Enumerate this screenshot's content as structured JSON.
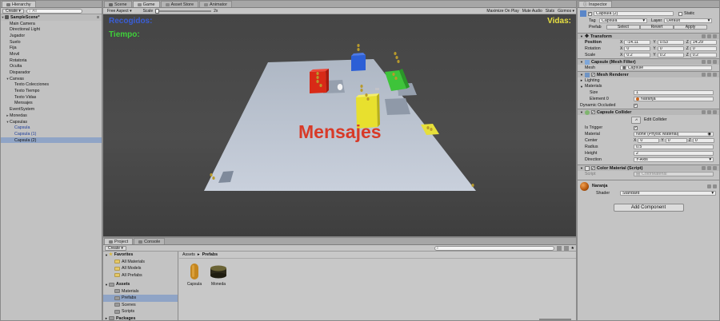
{
  "hierarchy": {
    "tab": "Hierarchy",
    "create": "Create",
    "search_placeholder": "All",
    "scene": "SampleScene*",
    "items": [
      {
        "label": "Main Camera",
        "indent": 1,
        "tw": "",
        "style": ""
      },
      {
        "label": "Directional Light",
        "indent": 1,
        "tw": "",
        "style": ""
      },
      {
        "label": "Jugador",
        "indent": 1,
        "tw": "",
        "style": ""
      },
      {
        "label": "Suelo",
        "indent": 1,
        "tw": "",
        "style": ""
      },
      {
        "label": "Fija",
        "indent": 1,
        "tw": "",
        "style": ""
      },
      {
        "label": "Movil",
        "indent": 1,
        "tw": "",
        "style": ""
      },
      {
        "label": "Rotatoria",
        "indent": 1,
        "tw": "",
        "style": ""
      },
      {
        "label": "Oculta",
        "indent": 1,
        "tw": "",
        "style": ""
      },
      {
        "label": "Disparador",
        "indent": 1,
        "tw": "",
        "style": ""
      },
      {
        "label": "Canvas",
        "indent": 1,
        "tw": "▼",
        "style": ""
      },
      {
        "label": "Texto Colecciones",
        "indent": 2,
        "tw": "",
        "style": ""
      },
      {
        "label": "Texto Tiempo",
        "indent": 2,
        "tw": "",
        "style": ""
      },
      {
        "label": "Texto Vidas",
        "indent": 2,
        "tw": "",
        "style": ""
      },
      {
        "label": "Mensajes",
        "indent": 2,
        "tw": "",
        "style": ""
      },
      {
        "label": "EventSystem",
        "indent": 1,
        "tw": "",
        "style": ""
      },
      {
        "label": "Monedas",
        "indent": 1,
        "tw": "►",
        "style": ""
      },
      {
        "label": "Capsulas",
        "indent": 1,
        "tw": "▼",
        "style": ""
      },
      {
        "label": "Capsula",
        "indent": 2,
        "tw": "",
        "style": "blue"
      },
      {
        "label": "Capsula (1)",
        "indent": 2,
        "tw": "",
        "style": "blue"
      },
      {
        "label": "Capsula (2)",
        "indent": 2,
        "tw": "",
        "style": "sel"
      }
    ]
  },
  "center": {
    "tabs": [
      {
        "label": "Scene",
        "icon": "hash",
        "active": false
      },
      {
        "label": "Game",
        "icon": "pacman",
        "active": true
      },
      {
        "label": "Asset Store",
        "icon": "bag",
        "active": false
      },
      {
        "label": "Animator",
        "icon": "anim",
        "active": false
      }
    ],
    "toolbar": {
      "aspect": "Free Aspect",
      "scale_label": "Scale",
      "scale_value": "2x",
      "maximize": "Maximize On Play",
      "mute": "Mute Audio",
      "stats": "Stats",
      "gizmos": "Gizmos"
    },
    "hud": {
      "colecciones": "Recogidos:",
      "tiempo": "Tiempo:",
      "vidas": "Vidas:",
      "mensajes": "Mensajes"
    }
  },
  "project": {
    "tabs": [
      {
        "label": "Project",
        "active": true
      },
      {
        "label": "Console",
        "active": false
      }
    ],
    "create": "Create",
    "favorites": "Favorites",
    "fav_items": [
      "All Materials",
      "All Models",
      "All Prefabs"
    ],
    "assets": "Assets",
    "asset_folders": [
      "Materials",
      "Prefabs",
      "Scenes",
      "Scripts"
    ],
    "packages": "Packages",
    "breadcrumb": [
      "Assets",
      "Prefabs"
    ],
    "items": [
      {
        "label": "Capsula"
      },
      {
        "label": "Moneda"
      }
    ]
  },
  "inspector": {
    "tab": "Inspector",
    "name": "Capsula (2)",
    "static": "Static",
    "tag_label": "Tag",
    "tag_value": "Capsula",
    "layer_label": "Layer",
    "layer_value": "Default",
    "prefab_label": "Prefab",
    "prefab_buttons": [
      "Select",
      "Revert",
      "Apply"
    ],
    "transform": {
      "title": "Transform",
      "rows": [
        {
          "label": "Position",
          "x": "-14.11",
          "y": "0.53",
          "z": "14.29"
        },
        {
          "label": "Rotation",
          "x": "0",
          "y": "0",
          "z": "0"
        },
        {
          "label": "Scale",
          "x": "0.2",
          "y": "0.2",
          "z": "0.2"
        }
      ]
    },
    "mesh_filter": {
      "title": "Capsule (Mesh Filter)",
      "mesh_label": "Mesh",
      "mesh_value": "Capsule"
    },
    "mesh_renderer": {
      "title": "Mesh Renderer",
      "lighting": "Lighting",
      "materials": "Materials",
      "size_label": "Size",
      "size_value": "1",
      "element_label": "Element 0",
      "element_value": "Naranja",
      "occluded": "Dynamic Occluded"
    },
    "collider": {
      "title": "Capsule Collider",
      "edit": "Edit Collider",
      "rows": [
        {
          "label": "Is Trigger",
          "value": ""
        },
        {
          "label": "Material",
          "value": "None (Physic Material)"
        },
        {
          "label": "Center",
          "x": "0",
          "y": "0",
          "z": "0"
        },
        {
          "label": "Radius",
          "value": "0.5"
        },
        {
          "label": "Height",
          "value": "2"
        },
        {
          "label": "Direction",
          "value": "Y-Axis"
        }
      ]
    },
    "script": {
      "title": "Color Material (Script)",
      "script_label": "Script",
      "script_value": "ColorMaterial"
    },
    "material": {
      "name": "Naranja",
      "shader_label": "Shader",
      "shader_value": "Standard"
    },
    "add_component": "Add Component"
  }
}
